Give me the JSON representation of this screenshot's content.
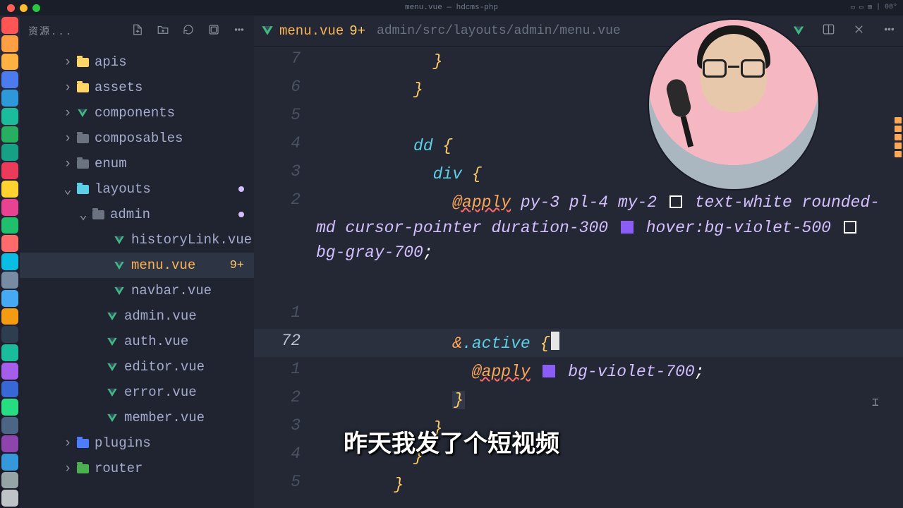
{
  "window": {
    "title": "menu.vue — hdcms-php"
  },
  "menubar_right": [
    "▭",
    "▭",
    "⊞",
    "|",
    "08°"
  ],
  "sidebar": {
    "title": "资源...",
    "tree": [
      {
        "indent": 60,
        "chev": ">",
        "icon": "folder-y",
        "label": "apis"
      },
      {
        "indent": 60,
        "chev": ">",
        "icon": "folder-y",
        "label": "assets"
      },
      {
        "indent": 60,
        "chev": ">",
        "icon": "vue",
        "label": "components"
      },
      {
        "indent": 60,
        "chev": ">",
        "icon": "folder-g",
        "label": "composables"
      },
      {
        "indent": 60,
        "chev": ">",
        "icon": "folder-g",
        "label": "enum"
      },
      {
        "indent": 60,
        "chev": "v",
        "icon": "folder-teal",
        "label": "layouts",
        "dirty": true
      },
      {
        "indent": 82,
        "chev": "v",
        "icon": "folder-g",
        "label": "admin",
        "dirty": true
      },
      {
        "indent": 112,
        "chev": "",
        "icon": "vue",
        "label": "historyLink.vue"
      },
      {
        "indent": 112,
        "chev": "",
        "icon": "vue",
        "label": "menu.vue",
        "badge": "9+",
        "active": true
      },
      {
        "indent": 112,
        "chev": "",
        "icon": "vue",
        "label": "navbar.vue"
      },
      {
        "indent": 102,
        "chev": "",
        "icon": "vue",
        "label": "admin.vue"
      },
      {
        "indent": 102,
        "chev": "",
        "icon": "vue",
        "label": "auth.vue"
      },
      {
        "indent": 102,
        "chev": "",
        "icon": "vue",
        "label": "editor.vue"
      },
      {
        "indent": 102,
        "chev": "",
        "icon": "vue",
        "label": "error.vue"
      },
      {
        "indent": 102,
        "chev": "",
        "icon": "vue",
        "label": "member.vue"
      },
      {
        "indent": 60,
        "chev": ">",
        "icon": "folder-blue",
        "label": "plugins"
      },
      {
        "indent": 60,
        "chev": ">",
        "icon": "folder-green",
        "label": "router"
      }
    ]
  },
  "tab": {
    "name": "menu.vue",
    "badge": "9+",
    "path": "admin/src/layouts/admin/menu.vue"
  },
  "gutter": [
    "7",
    "6",
    "5",
    "4",
    "3",
    "2",
    "",
    "",
    "",
    "1",
    "72",
    "1",
    "2",
    "3",
    "4",
    "5"
  ],
  "code": {
    "apply1_at": "@apply",
    "apply1": " py-3 pl-4 my-2 ",
    "apply1b": "text-white rounded-md cursor-pointer duration-300 ",
    "hover": "hover:bg-violet-500",
    "bggray": "bg-gray-700",
    "dd": "dd ",
    "div": "div ",
    "brace_o": "{",
    "brace_c": "}",
    "semi": ";",
    "amp": "&",
    "dot_active": ".active ",
    "apply2_at": "@apply",
    "bgv": "bg-violet-700"
  },
  "caption": "昨天我发了个短视频",
  "dock_colors": [
    "#ff5555",
    "#ff9f43",
    "#ffb142",
    "#4b7bec",
    "#2d98da",
    "#1abc9c",
    "#27ae60",
    "#16a085",
    "#eb3b5a",
    "#fed330",
    "#e84393",
    "#20bf6b",
    "#ff6b6b",
    "#0abde3",
    "#778ca3",
    "#45aaf2",
    "#f39c12",
    "#2c3e50",
    "#1abc9c",
    "#a55eea",
    "#3867d6",
    "#26de81",
    "#4b6584",
    "#8e44ad",
    "#3498db",
    "#95a5a6",
    "#bdc3c7"
  ]
}
